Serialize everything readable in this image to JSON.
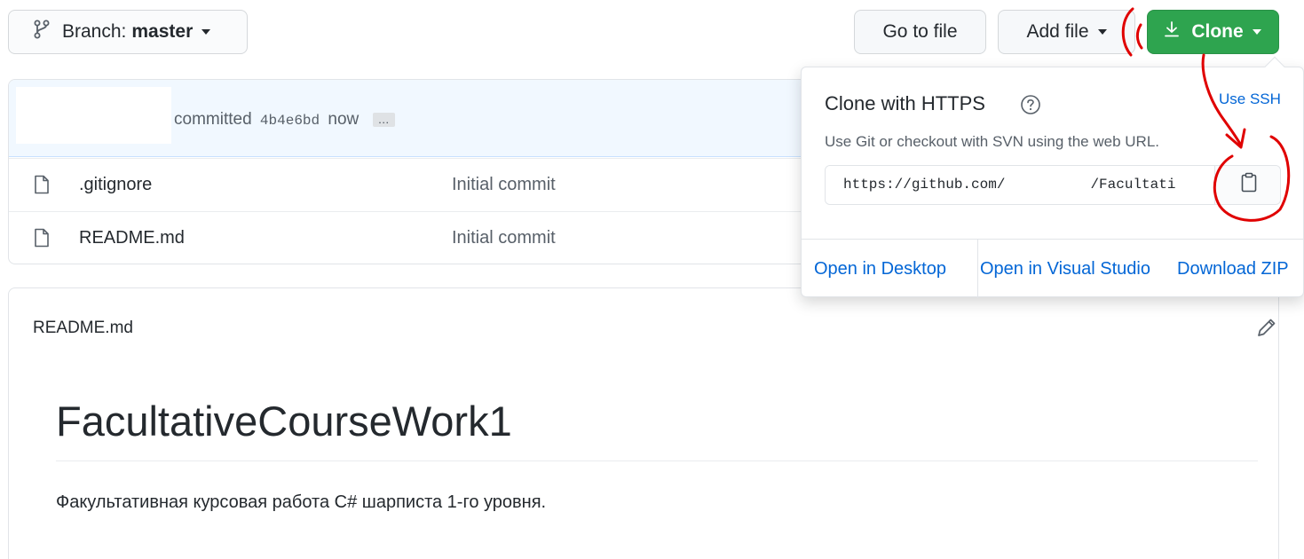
{
  "toolbar": {
    "branch_label": "Branch:",
    "branch_value": "master",
    "goto_label": "Go to file",
    "addfile_label": "Add file",
    "clone_label": "Clone"
  },
  "commit": {
    "text": "committed",
    "sha": "4b4e6bd",
    "time": "now",
    "ellipsis": "…"
  },
  "files": [
    {
      "name": ".gitignore",
      "message": "Initial commit"
    },
    {
      "name": "README.md",
      "message": "Initial commit"
    }
  ],
  "readme": {
    "header": "README.md",
    "title": "FacultativeCourseWork1",
    "text": "Факультативная курсовая работа C# шарписта 1-го уровня."
  },
  "clone_dropdown": {
    "title": "Clone with HTTPS",
    "use_ssh": "Use SSH",
    "subtitle": "Use Git or checkout with SVN using the web URL.",
    "url": "https://github.com/          /Facultati",
    "links": {
      "desktop": "Open in Desktop",
      "visual_studio": "Open in Visual Studio",
      "zip": "Download ZIP"
    }
  },
  "colors": {
    "clone_green": "#2ea44f",
    "link_blue": "#0366d6",
    "annotation_red": "#e00000"
  }
}
